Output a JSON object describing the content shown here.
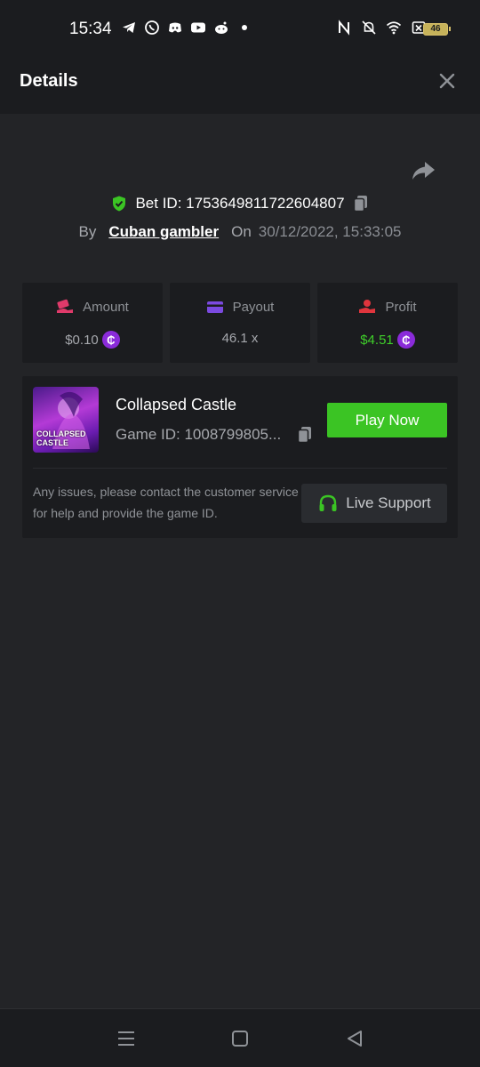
{
  "status_bar": {
    "time": "15:34",
    "battery": "46",
    "left_icons": [
      "telegram-icon",
      "whatsapp-icon",
      "discord-icon",
      "youtube-icon",
      "reddit-icon",
      "dot-icon"
    ],
    "right_icons": [
      "nfc-icon",
      "bell-off-icon",
      "wifi-icon",
      "no-sim-icon",
      "battery-icon"
    ]
  },
  "header": {
    "title": "Details",
    "close_icon": "close-icon"
  },
  "bet": {
    "bet_id": "Bet ID: 1753649811722604807",
    "by_label": "By",
    "user": "Cuban gambler",
    "on_label": "On",
    "date": "30/12/2022, 15:33:05"
  },
  "stats": {
    "amount_label": "Amount",
    "amount_value": "$0.10",
    "payout_label": "Payout",
    "payout_value": "46.1 x",
    "profit_label": "Profit",
    "profit_value": "$4.51",
    "coin_symbol": "₵"
  },
  "game": {
    "name": "Collapsed Castle",
    "game_id": "Game ID: 1008799805...",
    "thumb_line1": "COLLAPSED",
    "thumb_line2": "CASTLE",
    "play_label": "Play Now",
    "issues_text": "Any issues, please contact the customer service for help and provide the game ID.",
    "support_label": "Live Support"
  },
  "colors": {
    "accent_green": "#3bc424",
    "profit_green": "#3fcf2a",
    "coin_purple": "#8a2bd9",
    "amount_pink": "#e03a6a",
    "payout_purple": "#7b4ae0",
    "profit_red": "#e0353d"
  }
}
